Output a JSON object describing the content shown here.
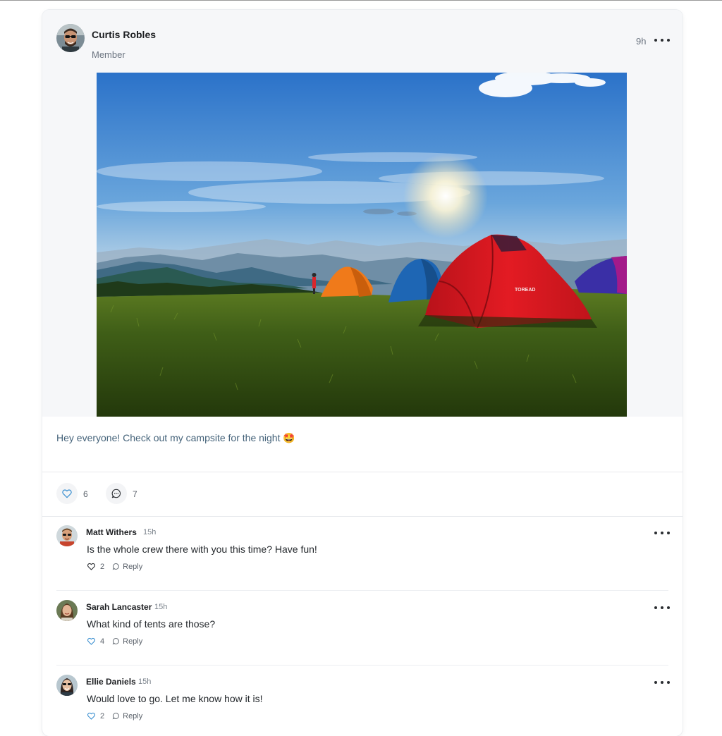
{
  "post": {
    "author": "Curtis Robles",
    "role": "Member",
    "time": "9h",
    "text": "Hey everyone! Check out my campsite for the night",
    "emoji": "🤩",
    "tent_brand": "TOREAD",
    "likes": "6",
    "comments": "7"
  },
  "comments": [
    {
      "name": "Matt Withers",
      "time": "15h",
      "text": "Is the whole crew there with you this time? Have fun!",
      "likes": "2",
      "reply_label": "Reply"
    },
    {
      "name": "Sarah Lancaster",
      "time": "15h",
      "text": "What kind of tents are those?",
      "likes": "4",
      "reply_label": "Reply"
    },
    {
      "name": "Ellie Daniels",
      "time": "15h",
      "text": "Would love to go. Let me know how it is!",
      "likes": "2",
      "reply_label": "Reply"
    }
  ],
  "colors": {
    "accent": "#3a8fd0",
    "header_bg": "#f6f7f9",
    "post_text": "#45637a"
  },
  "icons": {
    "like": "heart-icon",
    "comment": "comment-bubble-icon",
    "more": "more-horizontal-icon"
  }
}
